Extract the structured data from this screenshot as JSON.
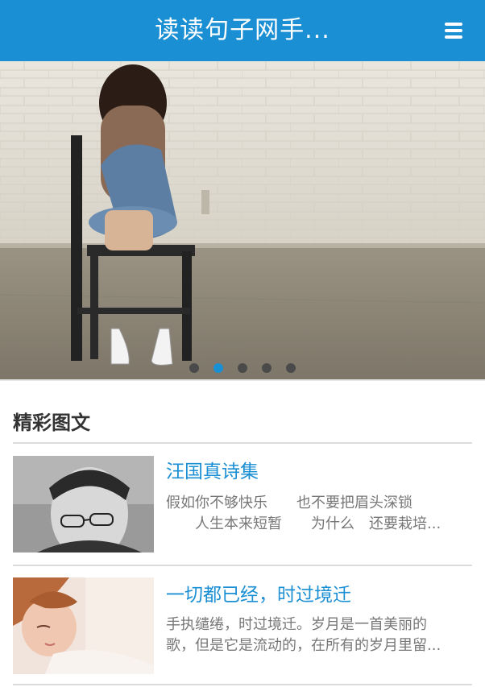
{
  "header": {
    "title": "读读句子网手...",
    "menu_icon": "menu-icon"
  },
  "banner": {
    "slide_count": 5,
    "active_index": 1
  },
  "section": {
    "title": "精彩图文"
  },
  "articles": [
    {
      "title": "汪国真诗集",
      "summary_line1": "假如你不够快乐　　也不要把眉头深锁",
      "summary_line2": "　　人生本来短暂　　为什么　还要栽培...",
      "thumb_icon": "portrait-man-glasses-image"
    },
    {
      "title": "一切都已经，时过境迁",
      "summary_line1": "手执缱绻，时过境迁。岁月是一首美丽的",
      "summary_line2": "歌，但是它是流动的，在所有的岁月里留...",
      "thumb_icon": "sleeping-woman-image"
    }
  ],
  "colors": {
    "accent": "#1b8fd3",
    "text": "#333333",
    "muted": "#777777"
  }
}
